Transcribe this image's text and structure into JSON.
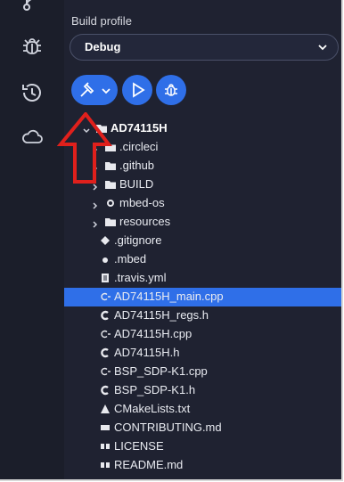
{
  "build": {
    "label": "Build profile",
    "selected": "Debug"
  },
  "activity": [
    {
      "icon": "source-control-icon"
    },
    {
      "icon": "bug-icon"
    },
    {
      "icon": "history-icon"
    },
    {
      "icon": "cloud-icon"
    }
  ],
  "actions": [
    {
      "icon": "hammer-icon",
      "label": "Build"
    },
    {
      "icon": "play-icon",
      "label": "Run"
    },
    {
      "icon": "debug-icon",
      "label": "Debug"
    }
  ],
  "tree": {
    "root": "AD74115H",
    "folders": [
      ".circleci",
      ".github",
      "BUILD",
      "mbed-os",
      "resources"
    ],
    "files": [
      ".gitignore",
      ".mbed",
      ".travis.yml",
      "AD74115H_main.cpp",
      "AD74115H_regs.h",
      "AD74115H.cpp",
      "AD74115H.h",
      "BSP_SDP-K1.cpp",
      "BSP_SDP-K1.h",
      "CMakeLists.txt",
      "CONTRIBUTING.md",
      "LICENSE",
      "README.md"
    ],
    "selected": "AD74115H_main.cpp"
  },
  "colors": {
    "accent": "#2f6fe8",
    "sidebar_bg": "#1b1e2a",
    "panel_bg": "#1f2231",
    "annotation_arrow": "#e0201c"
  }
}
